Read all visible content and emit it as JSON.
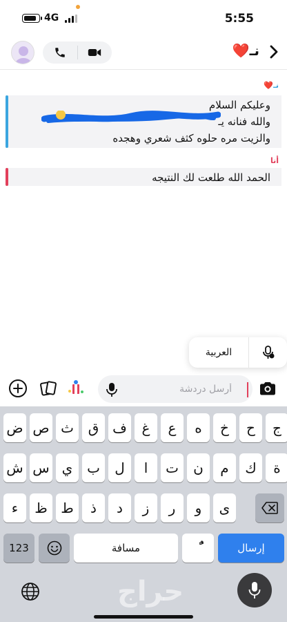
{
  "status_bar": {
    "time": "5:55",
    "network": "4G",
    "battery_level": 0.85
  },
  "header": {
    "contact_name": "نـ❤️",
    "icons": [
      "back-chevron-icon",
      "avatar",
      "phone-icon",
      "video-camera-icon"
    ]
  },
  "messages": [
    {
      "sender_label": "نـ❤️",
      "lines": [
        "وعليكم السلام",
        "والله فنانه يـ",
        "والزيت مره حلوه كثف شعري وهجده"
      ],
      "accent": "#3ba6e0"
    },
    {
      "sender_label": "أنا",
      "lines": [
        "الحمد الله  طلعت لك النتيجه"
      ],
      "accent": "#e2405b"
    }
  ],
  "language_popover": {
    "language": "العربية",
    "icon": "mic-settings-icon"
  },
  "input_bar": {
    "placeholder": "أرسل دردشة",
    "value": "",
    "icons": [
      "add-icon",
      "cards-icon",
      "gift-icon",
      "mic-icon",
      "camera-icon"
    ]
  },
  "keyboard": {
    "rows": [
      [
        "ض",
        "ص",
        "ث",
        "ق",
        "ف",
        "غ",
        "ع",
        "ه",
        "خ",
        "ح",
        "ج"
      ],
      [
        "ش",
        "س",
        "ي",
        "ب",
        "ل",
        "ا",
        "ت",
        "ن",
        "م",
        "ك",
        "ة"
      ],
      [
        "ء",
        "ظ",
        "ط",
        "ذ",
        "د",
        "ز",
        "ر",
        "و",
        "ى"
      ]
    ],
    "numbers_key": "123",
    "space_key": "مسافة",
    "diacritic_key": "ًٌ",
    "return_key": "إرسال",
    "accent_blue": "#2f80ed",
    "watermark": "حراج"
  }
}
